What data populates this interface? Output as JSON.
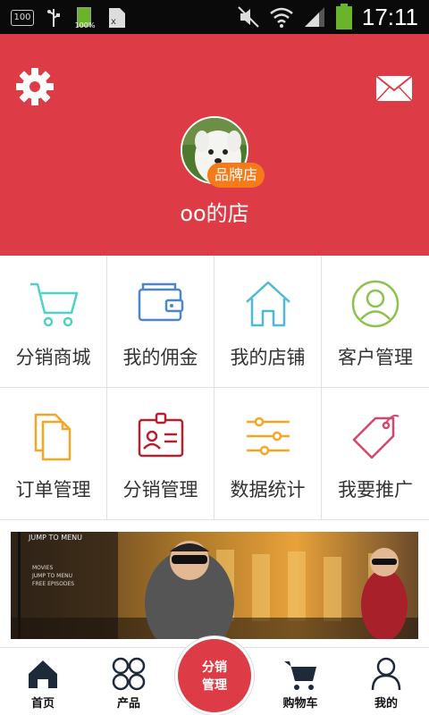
{
  "status_bar": {
    "storage": "100",
    "battery_small": "100%",
    "time": "17:11"
  },
  "header": {
    "badge": "品牌店",
    "shop_name": "oo的店",
    "color": "#dd3b46"
  },
  "grid": [
    {
      "label": "分销商城",
      "icon": "cart-icon",
      "color": "#4fd1c5"
    },
    {
      "label": "我的佣金",
      "icon": "wallet-icon",
      "color": "#4a86c8"
    },
    {
      "label": "我的店铺",
      "icon": "home-icon",
      "color": "#4fb8d8"
    },
    {
      "label": "客户管理",
      "icon": "user-circle-icon",
      "color": "#8bc34a"
    },
    {
      "label": "订单管理",
      "icon": "documents-icon",
      "color": "#f5a623"
    },
    {
      "label": "分销管理",
      "icon": "id-card-icon",
      "color": "#b3202f"
    },
    {
      "label": "数据统计",
      "icon": "sliders-icon",
      "color": "#f5a623"
    },
    {
      "label": "我要推广",
      "icon": "tag-icon",
      "color": "#d6456b"
    }
  ],
  "banner": {
    "menu_title": "JUMP TO MENU",
    "menu_items": [
      "MOVIES",
      "JUMP TO MENU",
      "FREE EPISODES"
    ]
  },
  "tabbar": {
    "home": "首页",
    "products": "产品",
    "center_line1": "分销",
    "center_line2": "管理",
    "cart": "购物车",
    "mine": "我的"
  }
}
